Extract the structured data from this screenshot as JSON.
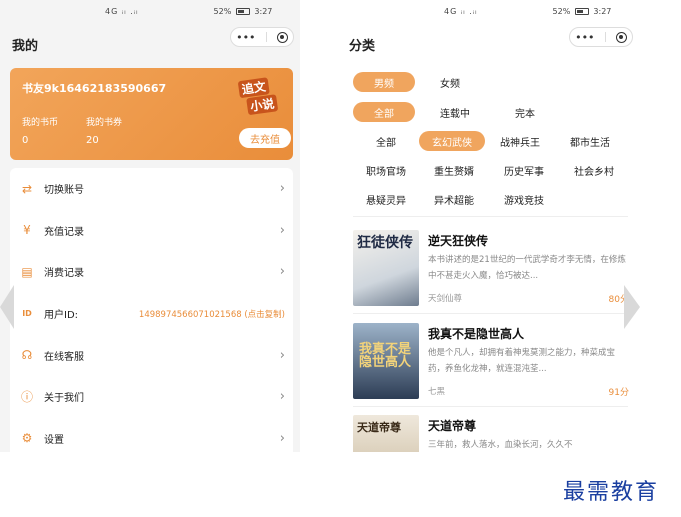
{
  "status_bar": {
    "signal": "4G ᵢₗ .ᵢₗ",
    "battery": "52%",
    "time": "3:27"
  },
  "capsule": {
    "more": "•••"
  },
  "profile": {
    "title": "我的",
    "username": "书友9k16462183590667",
    "coins_label": "我的书币",
    "coins_value": "0",
    "coupons_label": "我的书券",
    "coupons_value": "20",
    "logo_line1": "追文",
    "logo_line2": "小说",
    "recharge_button": "去充值",
    "menu": [
      {
        "label": "切换账号",
        "icon": "switch-account-icon",
        "glyph": "⇄"
      },
      {
        "label": "充值记录",
        "icon": "recharge-record-icon",
        "glyph": "¥"
      },
      {
        "label": "消费记录",
        "icon": "consume-record-icon",
        "glyph": "▤"
      },
      {
        "label": "用户ID:",
        "icon": "user-id-icon",
        "glyph": "ID",
        "value": "1498974566071021568 (点击复制)"
      },
      {
        "label": "在线客服",
        "icon": "customer-service-icon",
        "glyph": "☊"
      },
      {
        "label": "关于我们",
        "icon": "about-icon",
        "glyph": "ⓘ"
      },
      {
        "label": "设置",
        "icon": "settings-icon",
        "glyph": "⚙"
      }
    ]
  },
  "category": {
    "title": "分类",
    "gender_tabs": [
      "男频",
      "女频"
    ],
    "status_tabs": [
      "全部",
      "连载中",
      "完本"
    ],
    "genres_row1": [
      "全部",
      "玄幻武侠",
      "战神兵王",
      "都市生活"
    ],
    "genres_row2": [
      "职场官场",
      "重生赘婿",
      "历史军事",
      "社会乡村"
    ],
    "genres_row3": [
      "悬疑灵异",
      "异术超能",
      "游戏竞技"
    ],
    "books": [
      {
        "cover_text": "狂徒侠传",
        "title": "逆天狂侠传",
        "desc": "本书讲述的是21世纪的一代武学奇才李无情，在修炼中不甚走火入魔，恰巧被达...",
        "author": "天剑仙尊",
        "score": "80分"
      },
      {
        "cover_text": "我真不是隐世高人",
        "title": "我真不是隐世高人",
        "desc": "他是个凡人，却拥有着神鬼莫测之能力，种菜成宝药，养鱼化龙神，就连混沌荃...",
        "author": "七黑",
        "score": "91分"
      },
      {
        "cover_text": "天道帝尊",
        "title": "天道帝尊",
        "desc": "三年前，救人落水，血染长河，久久不",
        "author": "",
        "score": ""
      }
    ]
  },
  "watermark": "最需教育"
}
